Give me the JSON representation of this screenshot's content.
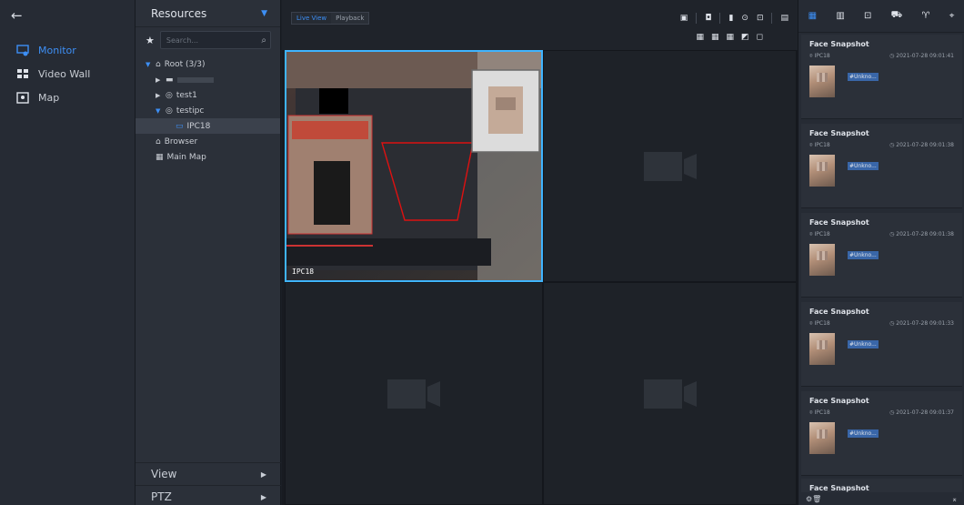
{
  "nav": {
    "back_glyph": "←",
    "items": [
      {
        "label": "Monitor",
        "icon": "monitor-icon",
        "active": true
      },
      {
        "label": "Video Wall",
        "icon": "video-wall-icon",
        "active": false
      },
      {
        "label": "Map",
        "icon": "map-icon",
        "active": false
      }
    ]
  },
  "resources": {
    "title": "Resources",
    "search_placeholder": "Search...",
    "tree": [
      {
        "label": "Root (3/3)"
      },
      {
        "label": ""
      },
      {
        "label": "test1"
      },
      {
        "label": "testipc"
      },
      {
        "label": "IPC18"
      },
      {
        "label": "Browser"
      },
      {
        "label": "Main Map"
      }
    ],
    "footer": [
      {
        "label": "View"
      },
      {
        "label": "PTZ"
      }
    ]
  },
  "view": {
    "tabs": [
      {
        "label": "Live View",
        "active": true
      },
      {
        "label": "Playback",
        "active": false
      }
    ],
    "live_cell_label": "IPC18"
  },
  "snapshots": {
    "cards": [
      {
        "title": "Face Snapshot",
        "camera": "IPC18",
        "time": "2021-07-28 09:01:41",
        "tag": "#Unkno..."
      },
      {
        "title": "Face Snapshot",
        "camera": "IPC18",
        "time": "2021-07-28 09:01:38",
        "tag": "#Unkno..."
      },
      {
        "title": "Face Snapshot",
        "camera": "IPC18",
        "time": "2021-07-28 09:01:38",
        "tag": "#Unkno..."
      },
      {
        "title": "Face Snapshot",
        "camera": "IPC18",
        "time": "2021-07-28 09:01:33",
        "tag": "#Unkno..."
      },
      {
        "title": "Face Snapshot",
        "camera": "IPC18",
        "time": "2021-07-28 09:01:37",
        "tag": "#Unkno..."
      },
      {
        "title": "Face Snapshot",
        "camera": "",
        "time": "",
        "tag": ""
      }
    ]
  },
  "colors": {
    "accent": "#3d8ff5",
    "live_border": "#3fb4ff"
  }
}
